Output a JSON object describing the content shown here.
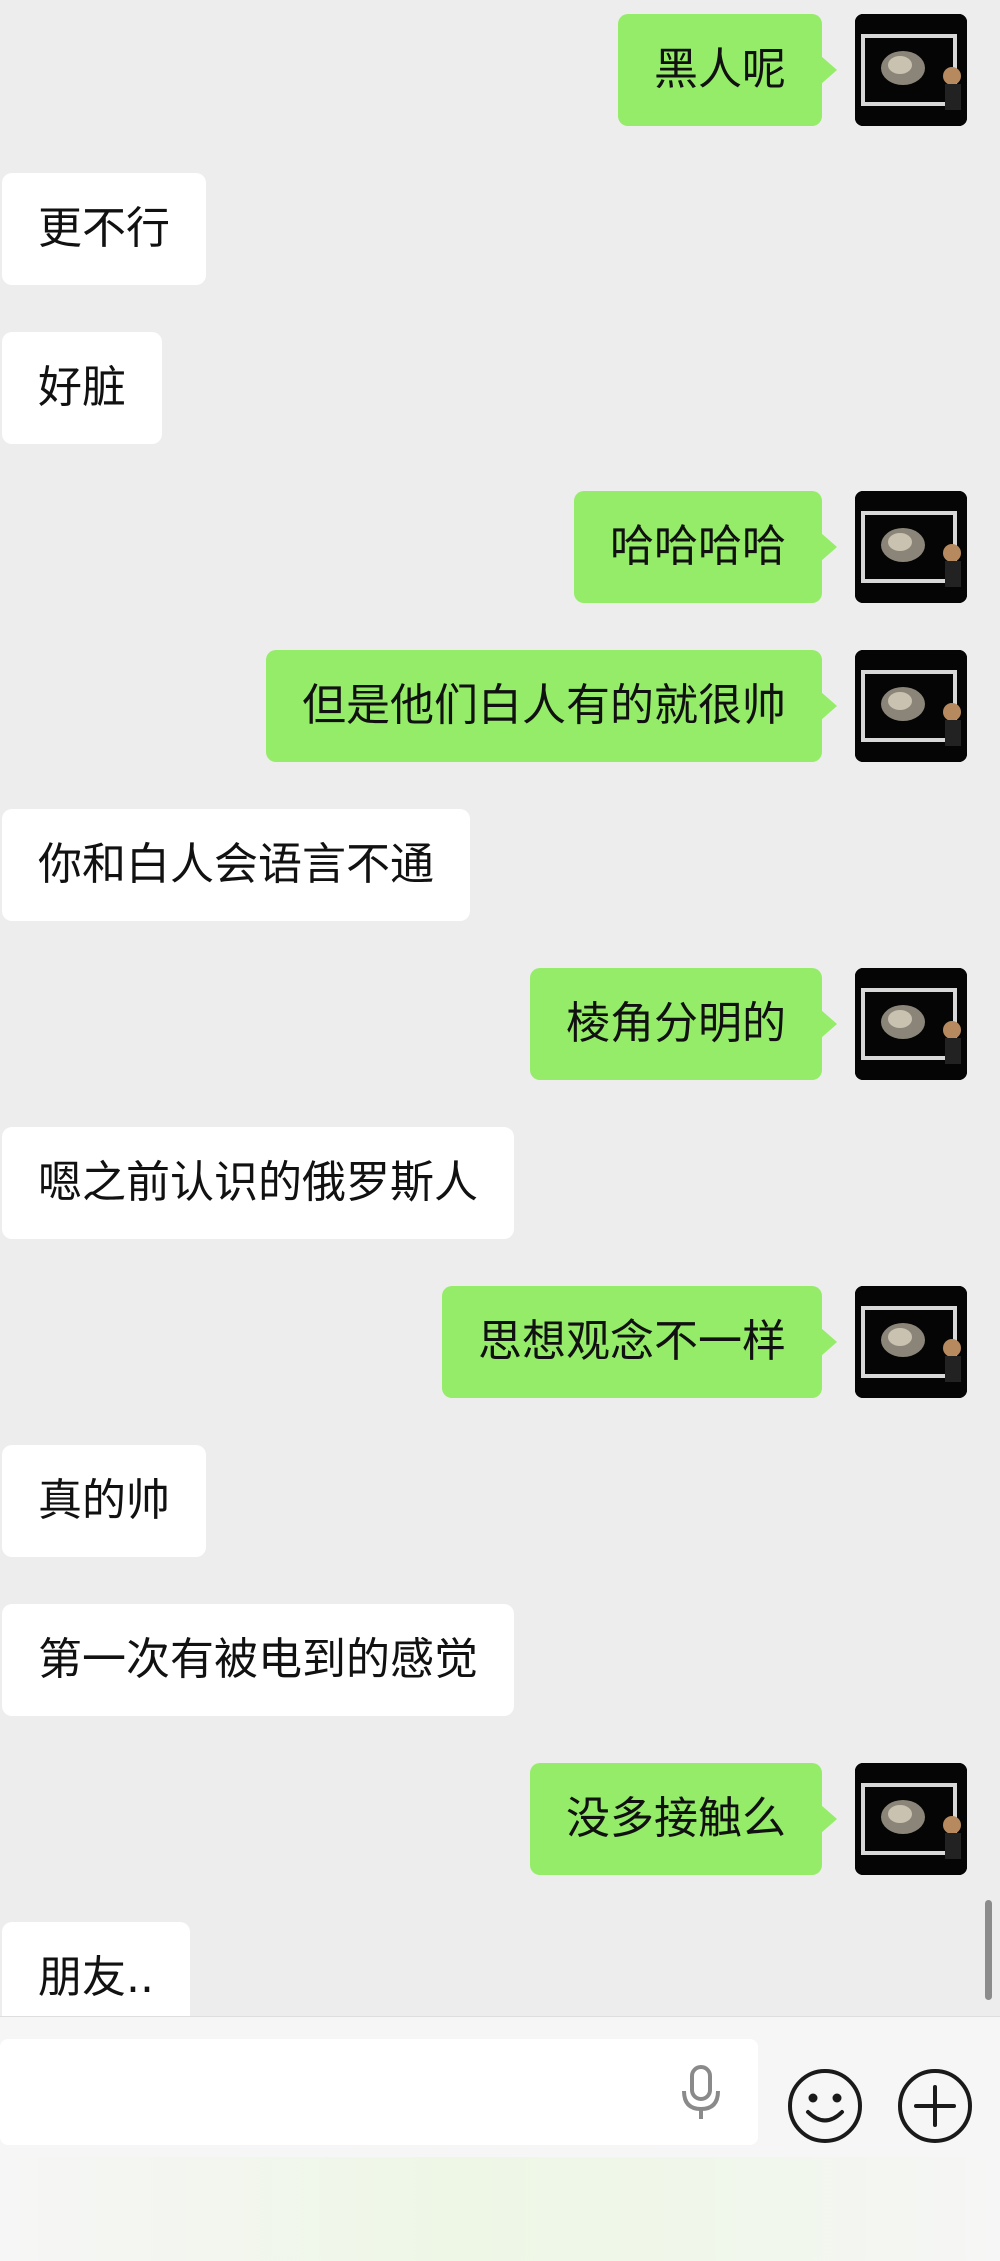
{
  "conversation": {
    "messages": [
      {
        "side": "out",
        "text": "黑人呢"
      },
      {
        "side": "in",
        "text": "更不行"
      },
      {
        "side": "in",
        "text": "好脏"
      },
      {
        "side": "out",
        "text": "哈哈哈哈"
      },
      {
        "side": "out",
        "text": "但是他们白人有的就很帅"
      },
      {
        "side": "in",
        "text": "你和白人会语言不通"
      },
      {
        "side": "out",
        "text": "棱角分明的"
      },
      {
        "side": "in",
        "text": "嗯之前认识的俄罗斯人"
      },
      {
        "side": "out",
        "text": "思想观念不一样"
      },
      {
        "side": "in",
        "text": "真的帅"
      },
      {
        "side": "in",
        "text": "第一次有被电到的感觉"
      },
      {
        "side": "out",
        "text": "没多接触么"
      },
      {
        "side": "in",
        "text": "朋友.."
      }
    ]
  },
  "composer": {
    "text_value": "",
    "voice_icon": "microphone-icon",
    "emoji_icon": "smiley-icon",
    "more_icon": "plus-circle-icon"
  },
  "colors": {
    "background": "#ededed",
    "outgoing_bubble": "#95ec69",
    "incoming_bubble": "#ffffff",
    "input_bar": "#f6f6f6"
  }
}
